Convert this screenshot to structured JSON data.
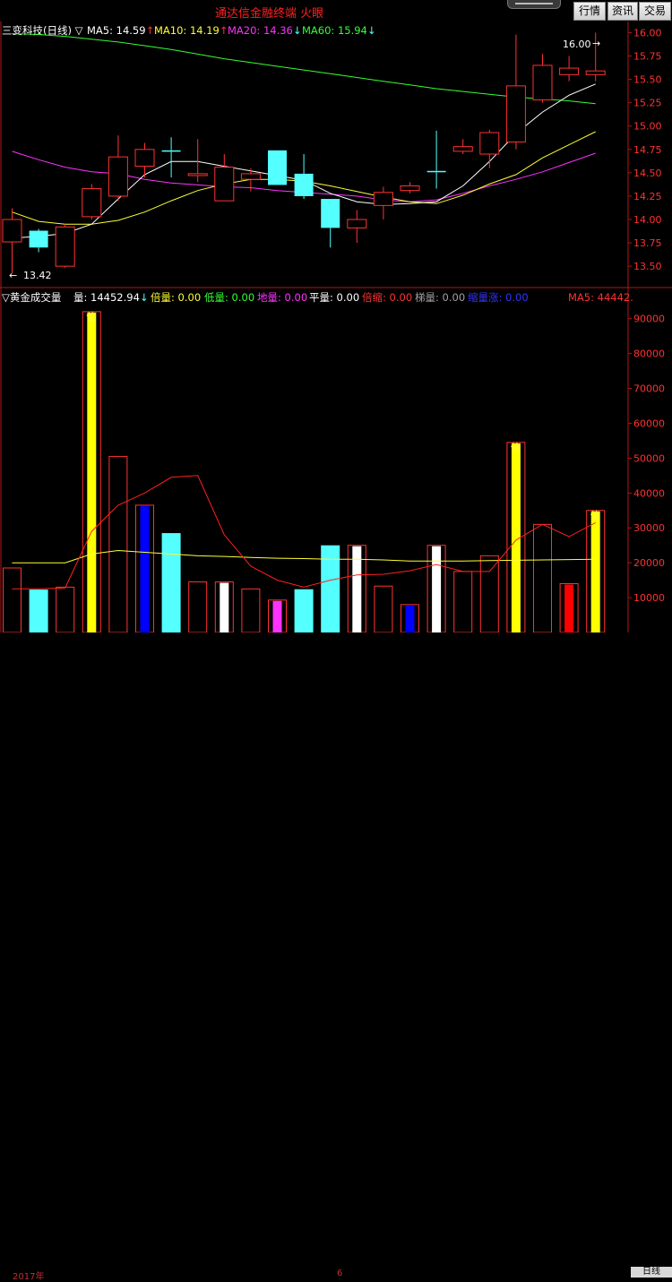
{
  "window": {
    "app_title": "通达信金融终端  火眼",
    "buttons": {
      "quote": "行情",
      "info": "资讯",
      "trade": "交易"
    }
  },
  "price_panel": {
    "indicator_label": "三变科技(日线) ▽",
    "ma_legend": [
      {
        "label": "MA5: 14.59",
        "arrow": "↑",
        "color": "#ffffff"
      },
      {
        "label": "MA10: 14.19",
        "arrow": "↑",
        "color": "#ffff33"
      },
      {
        "label": "MA20: 14.36",
        "arrow": "↓",
        "color": "#ff33ff"
      },
      {
        "label": "MA60: 15.94",
        "arrow": "↓",
        "color": "#33ff33"
      }
    ],
    "axis_ticks": [
      "16.00",
      "15.75",
      "15.50",
      "15.25",
      "15.00",
      "14.75",
      "14.50",
      "14.25",
      "14.00",
      "13.75",
      "13.50"
    ],
    "high_annotation": "16.00",
    "low_annotation": "13.42"
  },
  "volume_panel": {
    "title": "▽黄金成交量",
    "legend": [
      {
        "label": "量: 14452.94",
        "arrow": "↓",
        "color": "#ffffff"
      },
      {
        "label": "倍量: 0.00",
        "color": "#ffff33"
      },
      {
        "label": "低量: 0.00",
        "color": "#33ff33"
      },
      {
        "label": "地量: 0.00",
        "color": "#ff33ff"
      },
      {
        "label": "平量: 0.00",
        "color": "#ffffff"
      },
      {
        "label": "倍缩: 0.00",
        "color": "#ff3333"
      },
      {
        "label": "梯量: 0.00",
        "color": "#a0a0a0"
      },
      {
        "label": "缩量涨: 0.00",
        "color": "#3333ff"
      }
    ],
    "ma_label": "MA5: 44442.",
    "axis_ticks": [
      "90000",
      "80000",
      "70000",
      "60000",
      "50000",
      "40000",
      "30000",
      "20000",
      "10000"
    ],
    "bar_marker": "倍"
  },
  "timebar": {
    "year": "2017年",
    "month": "6",
    "period": "日线"
  },
  "colors": {
    "up": "#ff3232",
    "down": "#54ffff",
    "ma5": "#ffffff",
    "ma10": "#ffff33",
    "ma20": "#ff33ff",
    "ma60": "#33ff33",
    "grid": "#b01818"
  },
  "chart_data": [
    {
      "type": "candlestick",
      "title": "三变科技(日线)",
      "ylim": [
        13.3,
        16.1
      ],
      "candles": [
        {
          "o": 13.76,
          "c": 14.0,
          "h": 14.12,
          "l": 13.42,
          "up": true
        },
        {
          "o": 13.88,
          "c": 13.7,
          "h": 13.9,
          "l": 13.65,
          "up": false
        },
        {
          "o": 13.5,
          "c": 13.92,
          "h": 13.95,
          "l": 13.48,
          "up": true
        },
        {
          "o": 14.03,
          "c": 14.33,
          "h": 14.38,
          "l": 14.0,
          "up": true
        },
        {
          "o": 14.25,
          "c": 14.67,
          "h": 14.9,
          "l": 14.2,
          "up": true
        },
        {
          "o": 14.57,
          "c": 14.75,
          "h": 14.82,
          "l": 14.45,
          "up": true
        },
        {
          "o": 14.74,
          "c": 14.74,
          "h": 14.88,
          "l": 14.45,
          "up": false
        },
        {
          "o": 14.47,
          "c": 14.49,
          "h": 14.86,
          "l": 14.4,
          "up": true
        },
        {
          "o": 14.2,
          "c": 14.56,
          "h": 14.7,
          "l": 14.2,
          "up": true
        },
        {
          "o": 14.43,
          "c": 14.49,
          "h": 14.55,
          "l": 14.3,
          "up": true
        },
        {
          "o": 14.74,
          "c": 14.37,
          "h": 14.74,
          "l": 14.37,
          "up": false
        },
        {
          "o": 14.49,
          "c": 14.25,
          "h": 14.7,
          "l": 14.22,
          "up": false
        },
        {
          "o": 14.22,
          "c": 13.91,
          "h": 14.22,
          "l": 13.7,
          "up": false
        },
        {
          "o": 13.91,
          "c": 14.0,
          "h": 14.1,
          "l": 13.75,
          "up": true
        },
        {
          "o": 14.15,
          "c": 14.29,
          "h": 14.35,
          "l": 14.0,
          "up": true
        },
        {
          "o": 14.31,
          "c": 14.36,
          "h": 14.4,
          "l": 14.28,
          "up": true
        },
        {
          "o": 14.52,
          "c": 14.52,
          "h": 14.95,
          "l": 14.33,
          "up": false
        },
        {
          "o": 14.73,
          "c": 14.78,
          "h": 14.86,
          "l": 14.7,
          "up": true
        },
        {
          "o": 14.7,
          "c": 14.93,
          "h": 14.96,
          "l": 14.55,
          "up": true
        },
        {
          "o": 14.83,
          "c": 15.43,
          "h": 15.98,
          "l": 14.75,
          "up": true
        },
        {
          "o": 15.28,
          "c": 15.65,
          "h": 15.77,
          "l": 15.25,
          "up": true
        },
        {
          "o": 15.55,
          "c": 15.62,
          "h": 15.75,
          "l": 15.48,
          "up": true
        },
        {
          "o": 15.55,
          "c": 15.59,
          "h": 16.0,
          "l": 15.48,
          "up": true
        }
      ],
      "ma5": [
        13.8,
        13.82,
        13.85,
        13.95,
        14.22,
        14.48,
        14.62,
        14.62,
        14.57,
        14.52,
        14.47,
        14.42,
        14.28,
        14.19,
        14.16,
        14.17,
        14.19,
        14.36,
        14.62,
        14.92,
        15.15,
        15.33,
        15.45
      ],
      "ma10": [
        14.08,
        13.98,
        13.95,
        13.95,
        13.99,
        14.08,
        14.2,
        14.31,
        14.38,
        14.43,
        14.43,
        14.41,
        14.36,
        14.3,
        14.24,
        14.19,
        14.17,
        14.26,
        14.38,
        14.48,
        14.66,
        14.8,
        14.94
      ],
      "ma20": [
        14.73,
        14.64,
        14.56,
        14.51,
        14.49,
        14.43,
        14.39,
        14.37,
        14.35,
        14.34,
        14.31,
        14.29,
        14.27,
        14.25,
        14.21,
        14.19,
        14.21,
        14.28,
        14.36,
        14.43,
        14.51,
        14.61,
        14.71
      ],
      "ma60": [
        15.99,
        15.98,
        15.96,
        15.93,
        15.9,
        15.86,
        15.82,
        15.77,
        15.72,
        15.68,
        15.64,
        15.6,
        15.56,
        15.52,
        15.48,
        15.44,
        15.4,
        15.37,
        15.34,
        15.31,
        15.29,
        15.27,
        15.24
      ]
    },
    {
      "type": "bar",
      "title": "黄金成交量",
      "ylim": [
        0,
        93000
      ],
      "series": [
        {
          "name": "量",
          "values": [
            18500,
            12300,
            13000,
            92000,
            50500,
            36500,
            28500,
            14500,
            14500,
            12500,
            9300,
            12400,
            25000,
            25000,
            13300,
            8000,
            25000,
            17500,
            22000,
            54500,
            31000,
            14000,
            35000
          ]
        }
      ],
      "bar_colors": [
        "#ff3232",
        "#54ffff",
        "#ff3232",
        "#ffff00",
        "#ff3232",
        "#0000ff",
        "#54ffff",
        "#ff3232",
        "#ffffff",
        "#ff3232",
        "#ff33ff",
        "#54ffff",
        "#54ffff",
        "#ffffff",
        "#ff3232",
        "#0000ff",
        "#ffffff",
        "#ff3232",
        "#ff3232",
        "#ffff00",
        "#ff3232",
        "#ff0000",
        "#ffff00"
      ],
      "bar_style": [
        "hollow",
        "solid",
        "hollow",
        "thin",
        "hollow",
        "thin",
        "solid",
        "hollow",
        "thin",
        "hollow",
        "thin",
        "solid",
        "solid",
        "thin",
        "hollow",
        "thin",
        "thin",
        "hollow",
        "hollow",
        "thin",
        "hollow",
        "thin",
        "thin"
      ],
      "markers": [
        3,
        19,
        22
      ],
      "ma5": [
        12500,
        12500,
        12800,
        29000,
        36500,
        40000,
        44500,
        45000,
        28000,
        19000,
        15000,
        13000,
        15000,
        16500,
        16700,
        17700,
        19500,
        17500,
        17500,
        26500,
        31000,
        27500,
        31500
      ],
      "ma20": [
        20000,
        20000,
        20000,
        22500,
        23500,
        23000,
        22500,
        22000,
        21800,
        21500,
        21300,
        21200,
        21000,
        21000,
        20800,
        20500,
        20500,
        20500,
        20600,
        20700,
        20800,
        20900,
        21000
      ]
    }
  ]
}
